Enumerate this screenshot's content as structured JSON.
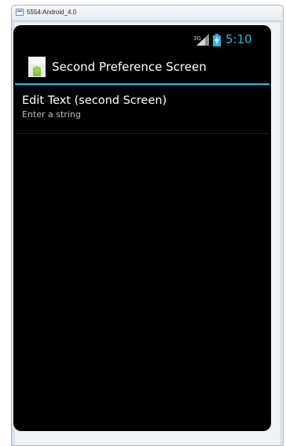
{
  "window": {
    "title": "5554:Android_4.0"
  },
  "statusbar": {
    "network_type": "3G",
    "time": "5:10",
    "icons": [
      "signal-icon",
      "battery-charging-icon"
    ],
    "clock_color": "#33b5e5"
  },
  "actionbar": {
    "icon": "android-app-icon",
    "title": "Second Preference Screen",
    "accent_color": "#33b5e5"
  },
  "preferences": [
    {
      "title": "Edit Text (second Screen)",
      "summary": "Enter a string"
    }
  ]
}
